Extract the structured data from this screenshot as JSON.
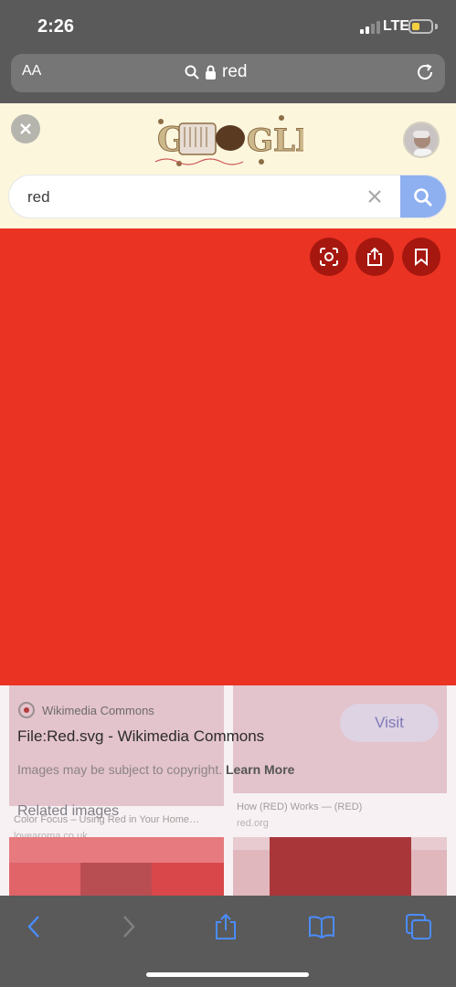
{
  "status_bar": {
    "time": "2:26",
    "network": "LTE",
    "signal_bars": 2,
    "battery_level": 0.4,
    "battery_color": "#f4d03f"
  },
  "url_bar": {
    "text_size_label": "AA",
    "url": "red"
  },
  "google": {
    "doodle_label": "Google Doodle",
    "search_query": "red",
    "accent": "#8fb0f0"
  },
  "image": {
    "color": "#ea3323"
  },
  "result": {
    "source": "Wikimedia Commons",
    "title": "File:Red.svg - Wikimedia Commons",
    "visit_label": "Visit",
    "copyright_text": "Images may be subject to copyright.",
    "learn_more": "Learn More",
    "related_label": "Related images"
  },
  "background_results": [
    {
      "caption": "Color Focus – Using Red in Your Home…",
      "site": "lovearoma.co.uk"
    },
    {
      "caption": "How (RED) Works — (RED)",
      "site": "red.org"
    }
  ]
}
